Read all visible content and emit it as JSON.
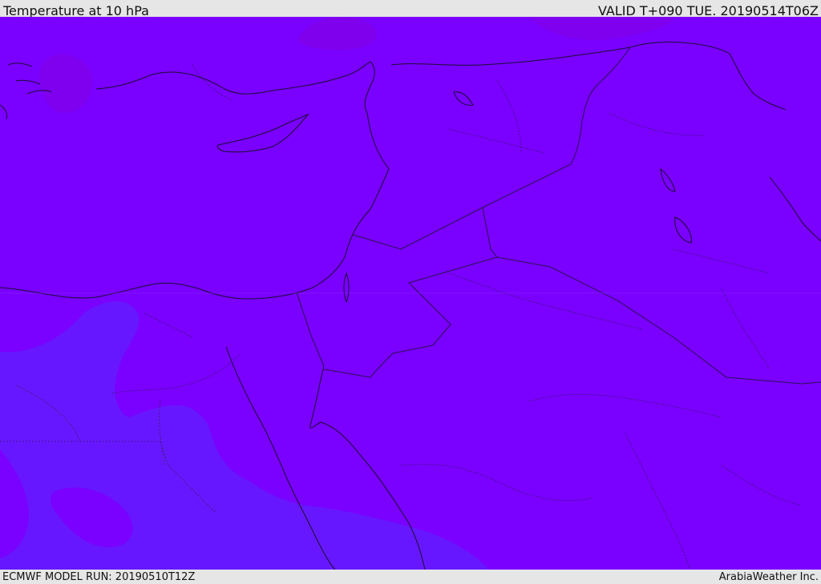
{
  "header": {
    "title": "Temperature at 10 hPa",
    "valid": "VALID T+090 TUE. 20190514T06Z"
  },
  "footer": {
    "model_run": "ECMWF MODEL RUN: 20190510T12Z",
    "credit": "ArabiaWeather Inc."
  },
  "colors": {
    "background_field": "#7a00ff",
    "cool_field": "#6618ff",
    "warm_field": "#8000ee",
    "coastline": "#1a1030",
    "border": "#2a1450"
  }
}
